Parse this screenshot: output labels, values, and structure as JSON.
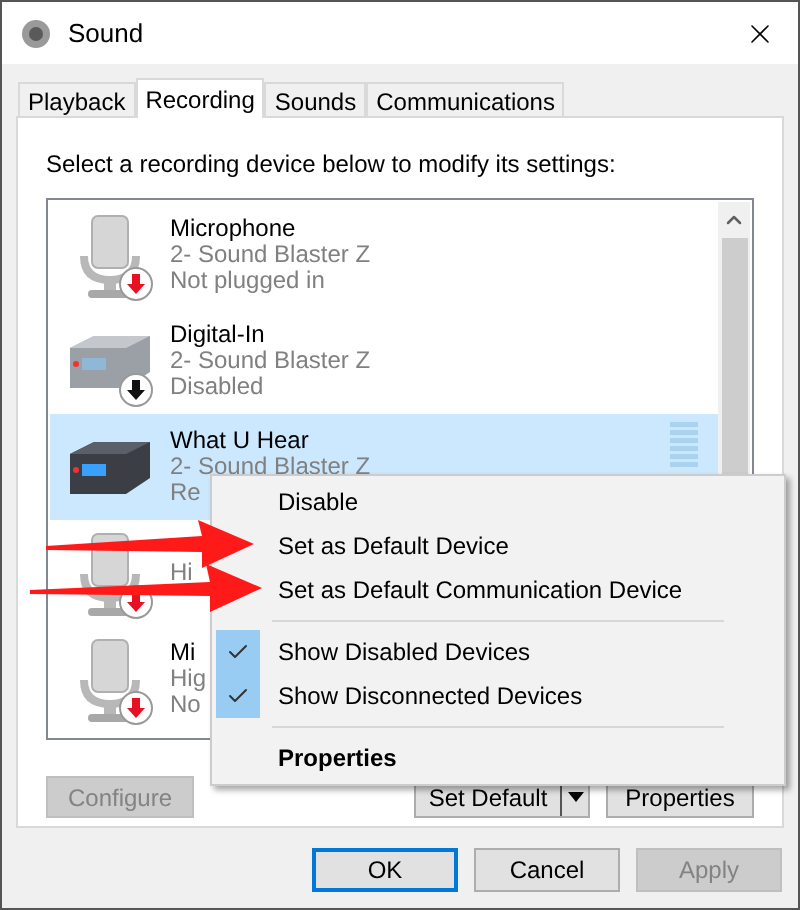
{
  "window": {
    "title": "Sound"
  },
  "tabs": [
    {
      "label": "Playback",
      "selected": false
    },
    {
      "label": "Recording",
      "selected": true
    },
    {
      "label": "Sounds",
      "selected": false
    },
    {
      "label": "Communications",
      "selected": false
    }
  ],
  "instruction": "Select a recording device below to modify its settings:",
  "devices": [
    {
      "kind": "microphone",
      "color": "#e81123",
      "name": "Microphone",
      "driver": "2- Sound Blaster Z",
      "status": "Not plugged in",
      "selected": false
    },
    {
      "kind": "box",
      "color": "#111111",
      "name": "Digital-In",
      "driver": "2- Sound Blaster Z",
      "status": "Disabled",
      "selected": false
    },
    {
      "kind": "dark-box",
      "name": "What U Hear",
      "driver": "2- Sound Blaster Z",
      "status": "Re",
      "selected": true
    },
    {
      "kind": "microphone",
      "color": "#e81123",
      "driver": "Hi",
      "selected": false
    },
    {
      "kind": "microphone",
      "color": "#e81123",
      "name": "Mi",
      "driver": "Hig",
      "status": "No",
      "selected": false
    }
  ],
  "context_menu": [
    {
      "kind": "item",
      "label": "Disable",
      "checked": false,
      "bold": false
    },
    {
      "kind": "item",
      "label": "Set as Default Device",
      "checked": false,
      "bold": false
    },
    {
      "kind": "item",
      "label": "Set as Default Communication Device",
      "checked": false,
      "bold": false
    },
    {
      "kind": "separator"
    },
    {
      "kind": "item",
      "label": "Show Disabled Devices",
      "checked": true,
      "bold": false
    },
    {
      "kind": "item",
      "label": "Show Disconnected Devices",
      "checked": true,
      "bold": false
    },
    {
      "kind": "separator"
    },
    {
      "kind": "item",
      "label": "Properties",
      "checked": false,
      "bold": true
    }
  ],
  "panel_buttons": [
    {
      "kind": "plain",
      "label": "Configure",
      "disabled": true
    },
    {
      "kind": "split",
      "label": "Set Default",
      "disabled": false
    },
    {
      "kind": "plain",
      "label": "Properties",
      "disabled": false
    }
  ],
  "dialog_buttons": [
    {
      "label": "OK",
      "disabled": false,
      "focused": true
    },
    {
      "label": "Cancel",
      "disabled": false,
      "focused": false
    },
    {
      "label": "Apply",
      "disabled": true,
      "focused": false
    }
  ]
}
